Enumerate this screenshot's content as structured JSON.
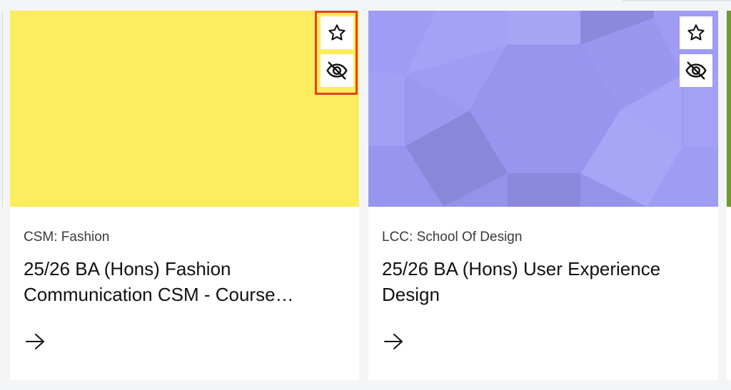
{
  "colors": {
    "card1_image": "#fced5e",
    "card2_image": "#9f9cf4",
    "card2_tile_dark": "#8a86da",
    "card2_tile_light": "#a9a6f7",
    "next_card_edge": "#6e9a2e",
    "highlight": "#e63f23"
  },
  "cards": [
    {
      "school": "CSM: Fashion",
      "title": "25/26 BA (Hons) Fashion Communication CSM - Course…",
      "icons": [
        "star-icon",
        "eye-off-icon",
        "arrow-right-icon"
      ]
    },
    {
      "school": "LCC: School Of Design",
      "title": "25/26 BA (Hons) User Experience Design",
      "icons": [
        "star-icon",
        "eye-off-icon",
        "arrow-right-icon"
      ]
    }
  ]
}
